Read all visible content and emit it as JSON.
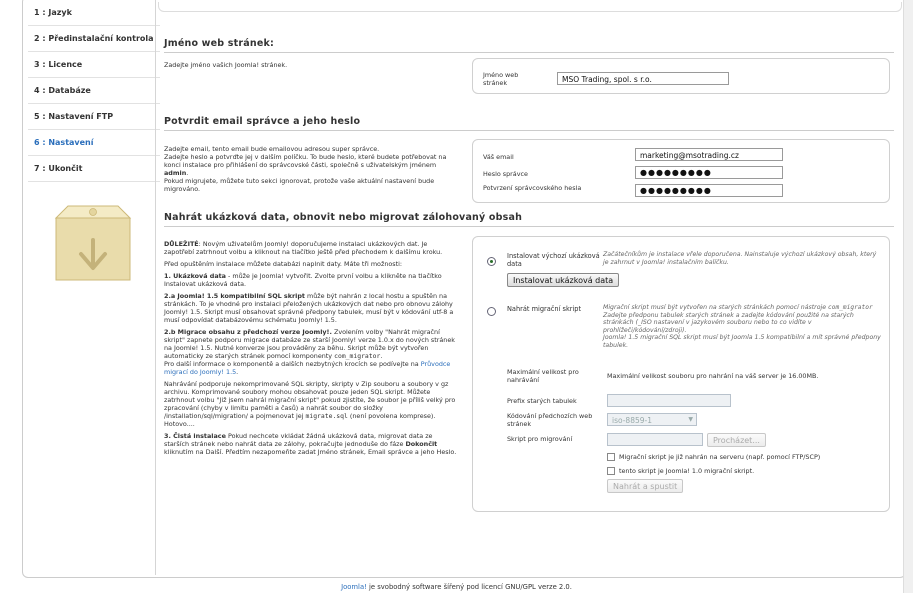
{
  "sidebar": {
    "steps": [
      {
        "label": "1 : Jazyk"
      },
      {
        "label": "2 : Předinstalační kontrola"
      },
      {
        "label": "3 : Licence"
      },
      {
        "label": "4 : Databáze"
      },
      {
        "label": "5 : Nastavení FTP"
      },
      {
        "label": "6 : Nastavení",
        "active": true
      },
      {
        "label": "7 : Ukončit"
      }
    ],
    "active_color": "#2a6ebb"
  },
  "site": {
    "title": "Jméno web stránek:",
    "desc": "Zadejte jméno vašich Joomla! stránek.",
    "label": "Jméno web stránek",
    "value": "MSO Trading, spol. s r.o."
  },
  "admin": {
    "title": "Potvrdit email správce a jeho heslo",
    "desc1": "Zadejte email, tento email bude emailovou adresou super správce.",
    "desc2": "Zadejte heslo a potvrďte jej v dalším políčku. To bude heslo, které budete potřebovat na konci instalace pro přihlášení do správcovské části, společně s uživatelským jménem",
    "desc2_bold": "admin",
    "desc3": "Pokud migrujete, můžete tuto sekci ignorovat, protože vaše aktuální nastavení bude migrováno.",
    "email_label": "Váš email",
    "email_value": "marketing@msotrading.cz",
    "pass_label": "Heslo správce",
    "pass_value": "●●●●●●●●●",
    "confirm_label": "Potvrzení správcovského hesla",
    "confirm_value": "●●●●●●●●●"
  },
  "sample": {
    "title": "Nahrát ukázková data, obnovit nebo migrovat zálohovaný obsah",
    "important_bold": "DŮLEŽITÉ",
    "important_text": ": Novým uživatelům Joomly! doporučujeme instalaci ukázkových dat. Je zapotřebí zatrhnout volbu a kliknout na tlačítko ještě před přechodem k dalšímu kroku.",
    "before": "Před opuštěním instalace můžete databázi naplnit daty. Máte tři možnosti:",
    "opt1_bold": "1. Ukázková data",
    "opt1_text": " - může je Joomla! vytvořit. Zvolte první volbu a klikněte na tlačítko Instalovat ukázková data.",
    "opt2a_bold": "2.a Joomla! 1.5 kompatibilní SQL skript",
    "opt2a_text": " může být nahrán z local hostu a spuštěn na stránkách. To je vhodné pro instalaci přeložených ukázkových dat nebo pro obnovu zálohy Joomly! 1.5. Skript musí obsahovat správné předpony tabulek, musí být v kódování utf-8 a musí odpovídat databázovému schématu Joomly! 1.5.",
    "opt2b_bold": "2.b Migrace obsahu z předchozí verze Joomly!.",
    "opt2b_text": " Zvolením volby \"Nahrát migrační skript\" zapnete podporu migrace databáze ze starší Joomly! verze 1.0.x do nových stránek na Joomle! 1.5. Nutné konverze jsou prováděny za běhu. Skript může být vytvořen automaticky ze starých stránek pomocí komponenty",
    "opt2b_mono": "com_migrator",
    "opt2b_more": "Pro další informace o komponentě a dalších nezbytných krocích se podívejte na",
    "opt2b_link": "Průvodce migrací do Joomly! 1.5",
    "upload_text": "Nahrávání podporuje nekomprimované SQL skripty, skripty v Zip souboru a soubory v gz archivu. Komprimované soubory mohou obsahovat pouze jeden SQL skript. Můžete zatrhnout volbu \"Již jsem nahrál migrační skript\" pokud zjistíte, že soubor je příliš velký pro zpracování (chyby v limitu paměti a časů) a nahrát soubor do složky /installation/sql/migration/ a pojmenovat jej",
    "upload_mono": "migrate.sql",
    "upload_tail": "(není povolena komprese). Hotovo....",
    "opt3_bold": "3. Čistá instalace",
    "opt3_text": " Pokud nechcete vkládat žádná ukázková data, migrovat data ze starších stránek nebo nahrát data ze zálohy, pokračujte jednoduše do fáze",
    "opt3_bold2": "Dokončit",
    "opt3_tail": " kliknutím na Další. Předtím nezapomeňte zadat Jméno stránek, Email správce a jeho Heslo.",
    "install_radio_label": "Instalovat výchozí ukázková data",
    "install_note": "Začátečníkům je instalace vřele doporučena. Nainstaluje výchozí ukázkový obsah, který je zahrnut v Joomla! instalačním balíčku.",
    "install_button": "Instalovat ukázková data",
    "migrate_radio_label": "Nahrát migrační skript",
    "migrate_note1": "Migrační skript musí být vytvořen na starých stránkách pomocí nástroje",
    "migrate_note_mono": "com_migrator",
    "migrate_note2": "Zadejte předponu tabulek starých stránek a zadejte kódování použité na starých stránkách (_ISO nastavení v jazykovém souboru nebo to co vidíte v prohlížeči/kódování/zdroji).",
    "migrate_note3": "Joomla! 1.5 migrační SQL skript musí být Joomla 1.5 kompatibilní a mít správné předpony tabulek.",
    "max_size_label": "Maximální velikost pro nahrávání",
    "max_size_value": "Maximální velikost souboru pro nahrání na váš server je 16.00MB.",
    "prefix_label": "Prefix starých tabulek",
    "encoding_label": "Kódování předchozích web stránek",
    "encoding_value": "iso-8859-1",
    "script_label": "Skript pro migrování",
    "browse_button": "Procházet...",
    "chk1_label": "Migrační skript je již nahrán na serveru (např. pomocí FTP/SCP)",
    "chk2_label": "tento skript je Joomla! 1.0 migrační skript.",
    "upload_button": "Nahrát a spustit"
  },
  "footer": {
    "link": "Joomla!",
    "text": " je svobodný software šířený pod licencí GNU/GPL verze 2.0."
  }
}
